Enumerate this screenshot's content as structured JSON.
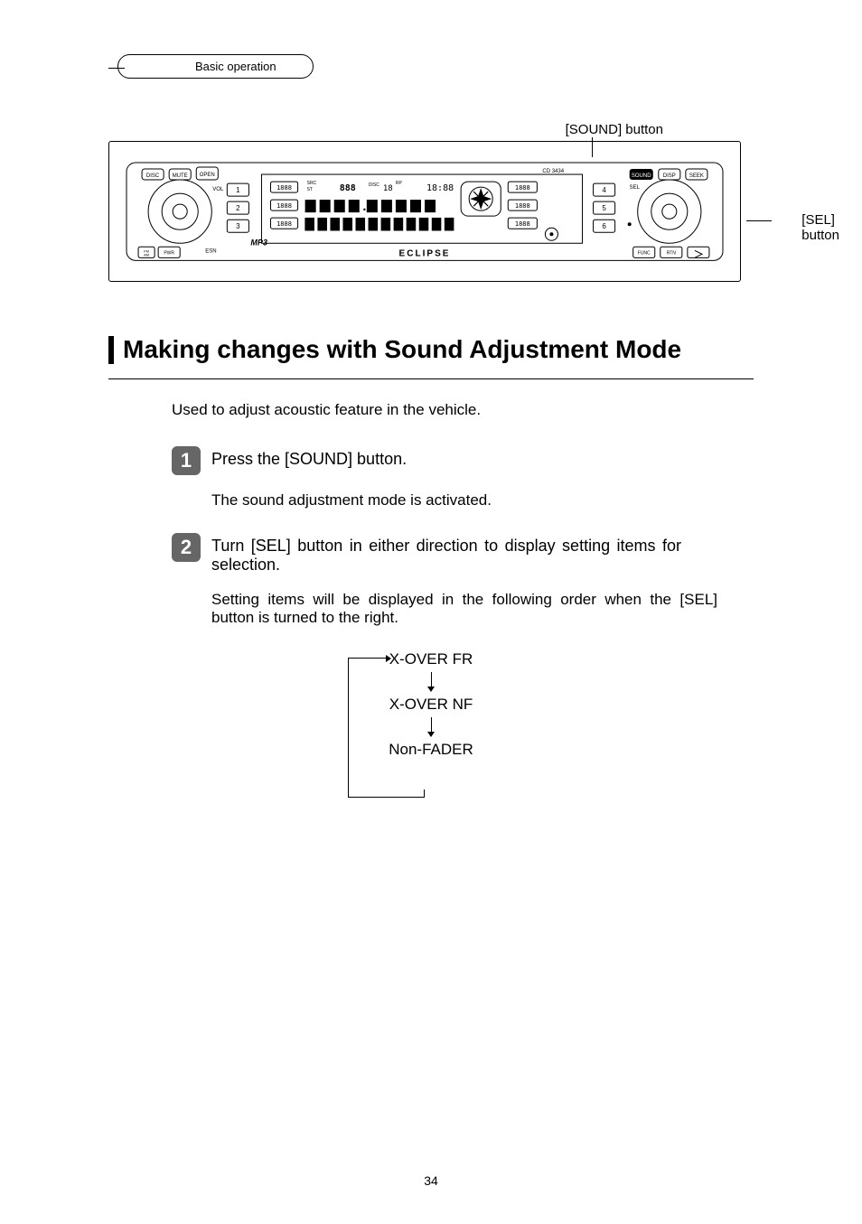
{
  "header": {
    "breadcrumb": "Basic operation"
  },
  "callouts": {
    "top": "[SOUND] button",
    "right_line1": "[SEL]",
    "right_line2": "button"
  },
  "section": {
    "title": "Making changes with Sound Adjustment Mode",
    "intro": "Used to adjust acoustic feature in the vehicle."
  },
  "steps": [
    {
      "num": "1",
      "title": "Press the [SOUND] button.",
      "body": "The sound adjustment mode is activated."
    },
    {
      "num": "2",
      "title": "Turn [SEL] button in either direction to display setting items for selection.",
      "body": "Setting items will be displayed in the following order when the [SEL] button is turned to the right."
    }
  ],
  "flow": {
    "items": [
      "X-OVER FR",
      "X-OVER NF",
      "Non-FADER"
    ]
  },
  "page_number": "34"
}
